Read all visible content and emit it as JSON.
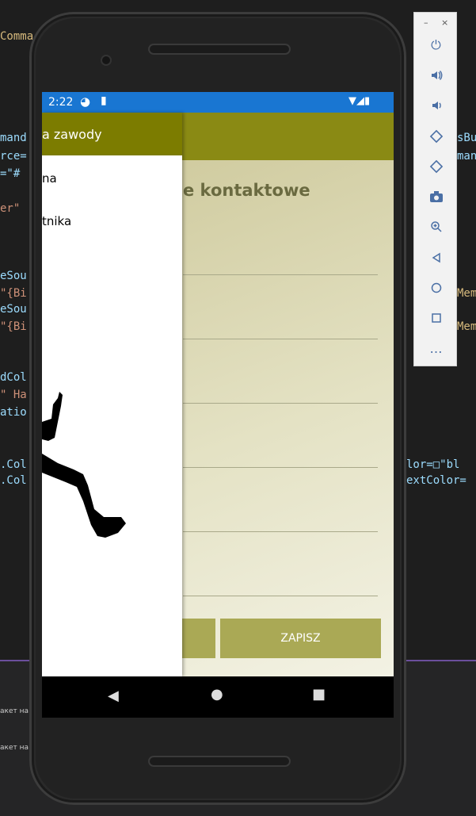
{
  "ide": {
    "code_left": [
      "Comma",
      "",
      "",
      "",
      "mand",
      "rce=",
      "=\"#",
      "",
      "er\"",
      "",
      "",
      "",
      "eSou",
      "\"{Bi",
      "eSou",
      "\"{Bi",
      "",
      "",
      "dCol",
      "\" Ha",
      "atio",
      "",
      "",
      ".Col",
      ".Col"
    ],
    "code_right": [
      "sBu",
      "man",
      "Mem",
      "Mem",
      "lor=□\"bl",
      "extColor="
    ],
    "bottom_left_1": "акет на",
    "bottom_left_2": "акет на"
  },
  "emulator_toolbar": {
    "minimize": "–",
    "close": "×",
    "buttons": [
      "power-icon",
      "volume-up-icon",
      "volume-down-icon",
      "rotate-left-icon",
      "rotate-right-icon",
      "camera-icon",
      "zoom-icon",
      "back-icon",
      "home-icon",
      "overview-icon",
      "more-icon"
    ],
    "glyphs": [
      "⏻",
      "🔊",
      "🔉",
      "⟲",
      "⟳",
      "📷",
      "⊕",
      "◁",
      "○",
      "□",
      "…"
    ]
  },
  "status_bar": {
    "time": "2:22",
    "left_icons": [
      "◕",
      "▮"
    ],
    "right_icons": "▼◢▮"
  },
  "app": {
    "content_title": "e kontaktowe",
    "save_button": "ZAPISZ",
    "left_button": ""
  },
  "drawer": {
    "header": "a zawody",
    "items": [
      "na",
      "tnika"
    ]
  },
  "nav_bar": {
    "back": "◀",
    "home": "●",
    "recents": "■"
  },
  "colors": {
    "status_bar": "#1976d2",
    "app_bar": "#8a8a14",
    "drawer_header": "#7c7c00",
    "button": "#aaa955"
  }
}
